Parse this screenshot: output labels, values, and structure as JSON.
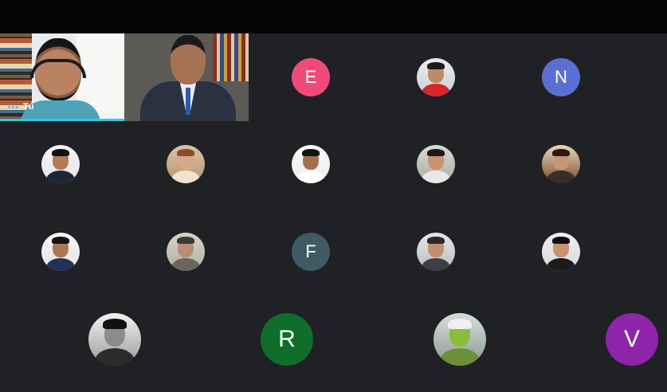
{
  "meeting": {
    "self_tile": {
      "label": "Tú"
    },
    "participants": [
      {
        "id": "p-e",
        "type": "initial",
        "initial": "E",
        "color": "#f04a7b",
        "row": 1,
        "col": 3
      },
      {
        "id": "p-red-shirt",
        "type": "photo",
        "photo": "person-red-shirt",
        "row": 1,
        "col": 4
      },
      {
        "id": "p-n",
        "type": "initial",
        "initial": "N",
        "color": "#5b6fd3",
        "row": 1,
        "col": 5
      },
      {
        "id": "p-suit-1",
        "type": "photo",
        "photo": "person-suit",
        "row": 2,
        "col": 1
      },
      {
        "id": "p-girl-beige",
        "type": "photo",
        "photo": "person-beige",
        "row": 2,
        "col": 2
      },
      {
        "id": "p-boy-white",
        "type": "photo",
        "photo": "person-white-shirt",
        "row": 2,
        "col": 3
      },
      {
        "id": "p-young-man",
        "type": "photo",
        "photo": "person-casual",
        "row": 2,
        "col": 4
      },
      {
        "id": "p-room",
        "type": "photo",
        "photo": "person-room",
        "row": 2,
        "col": 5
      },
      {
        "id": "p-suit-2",
        "type": "photo",
        "photo": "person-suit-blue",
        "row": 3,
        "col": 1
      },
      {
        "id": "p-sunglasses",
        "type": "photo",
        "photo": "person-sunglasses",
        "row": 3,
        "col": 2
      },
      {
        "id": "p-f",
        "type": "initial",
        "initial": "F",
        "color": "#3e5b63",
        "row": 3,
        "col": 3
      },
      {
        "id": "p-man-grey",
        "type": "photo",
        "photo": "person-grey",
        "row": 3,
        "col": 4
      },
      {
        "id": "p-woman-dark",
        "type": "photo",
        "photo": "person-dark-hair",
        "row": 3,
        "col": 5
      },
      {
        "id": "p-bw",
        "type": "photo",
        "photo": "person-black-white",
        "row": 4,
        "col": 1
      },
      {
        "id": "p-r",
        "type": "initial",
        "initial": "R",
        "color": "#0f6e2c",
        "row": 4,
        "col": 2
      },
      {
        "id": "p-plant",
        "type": "photo",
        "photo": "plant",
        "row": 4,
        "col": 3
      },
      {
        "id": "p-v",
        "type": "initial",
        "initial": "V",
        "color": "#8e24aa",
        "row": 4,
        "col": 4
      }
    ]
  },
  "colors": {
    "background": "#202124",
    "topbar": "#050505",
    "speaking_indicator": "#36c9e1"
  }
}
